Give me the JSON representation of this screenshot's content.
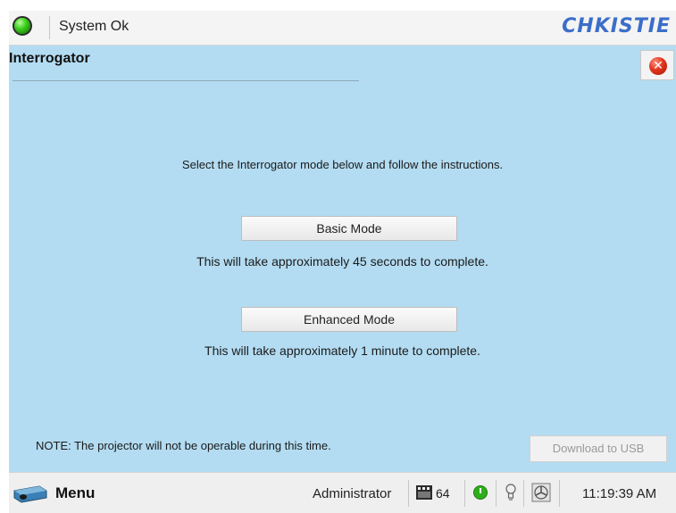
{
  "header": {
    "status_text": "System Ok",
    "logo_text": "CHKISTIE"
  },
  "panel": {
    "title": "Interrogator",
    "instructions": "Select the Interrogator mode below and follow the instructions.",
    "basic_mode": {
      "label": "Basic Mode",
      "description": "This will take approximately 45 seconds to complete."
    },
    "enhanced_mode": {
      "label": "Enhanced Mode",
      "description": "This will take approximately 1 minute to complete."
    },
    "note": "NOTE: The projector will not be operable during this time.",
    "download_label": "Download to USB"
  },
  "taskbar": {
    "menu_label": "Menu",
    "user": "Administrator",
    "count": "64",
    "time": "11:19:39 AM"
  },
  "colors": {
    "panel_background": "#b3dcf2",
    "status_ok": "#3fcf1f",
    "close": "#e0341e",
    "logo": "#3b6ec9"
  },
  "icons": [
    "status-ok-icon",
    "close-icon",
    "projector-menu-icon",
    "film-icon",
    "power-icon",
    "lamp-icon",
    "fan-icon"
  ]
}
